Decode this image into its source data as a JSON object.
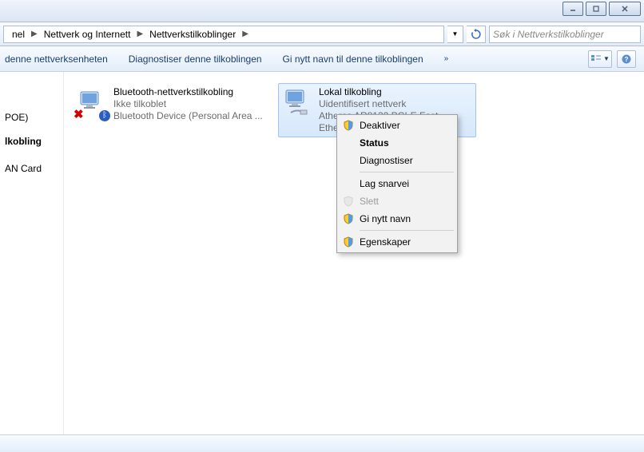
{
  "window": {
    "buttons": {
      "min": "—",
      "max": "▢",
      "close": "✕"
    }
  },
  "breadcrumb": {
    "seg0": "nel",
    "seg1": "Nettverk og Internett",
    "seg2": "Nettverkstilkoblinger"
  },
  "search": {
    "placeholder": "Søk i Nettverkstilkoblinger"
  },
  "commandbar": {
    "item1": "denne nettverksenheten",
    "item2": "Diagnostiser denne tilkoblingen",
    "item3": "Gi nytt navn til denne tilkoblingen",
    "more": "»"
  },
  "sidebar": {
    "item1": "POE)",
    "item2": "lkobling",
    "item3": "AN Card"
  },
  "connections": [
    {
      "title": "Bluetooth-nettverkstilkobling",
      "sub1": "Ikke tilkoblet",
      "sub2": "Bluetooth Device (Personal Area ..."
    },
    {
      "title": "Lokal tilkobling",
      "sub1": "Uidentifisert nettverk",
      "sub2": "Atheros AR8132 PCI-E Fast Ethern..."
    }
  ],
  "context_menu": {
    "deactivate": "Deaktiver",
    "status": "Status",
    "diagnose": "Diagnostiser",
    "shortcut": "Lag snarvei",
    "delete": "Slett",
    "rename": "Gi nytt navn",
    "properties": "Egenskaper"
  }
}
